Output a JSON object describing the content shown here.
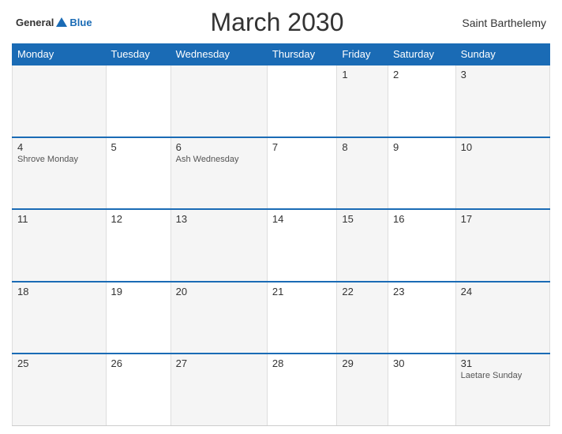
{
  "header": {
    "logo_general": "General",
    "logo_blue": "Blue",
    "title": "March 2030",
    "region": "Saint Barthelemy"
  },
  "days_of_week": [
    "Monday",
    "Tuesday",
    "Wednesday",
    "Thursday",
    "Friday",
    "Saturday",
    "Sunday"
  ],
  "weeks": [
    [
      {
        "day": "",
        "event": ""
      },
      {
        "day": "",
        "event": ""
      },
      {
        "day": "",
        "event": ""
      },
      {
        "day": "",
        "event": ""
      },
      {
        "day": "1",
        "event": ""
      },
      {
        "day": "2",
        "event": ""
      },
      {
        "day": "3",
        "event": ""
      }
    ],
    [
      {
        "day": "4",
        "event": "Shrove Monday"
      },
      {
        "day": "5",
        "event": ""
      },
      {
        "day": "6",
        "event": "Ash Wednesday"
      },
      {
        "day": "7",
        "event": ""
      },
      {
        "day": "8",
        "event": ""
      },
      {
        "day": "9",
        "event": ""
      },
      {
        "day": "10",
        "event": ""
      }
    ],
    [
      {
        "day": "11",
        "event": ""
      },
      {
        "day": "12",
        "event": ""
      },
      {
        "day": "13",
        "event": ""
      },
      {
        "day": "14",
        "event": ""
      },
      {
        "day": "15",
        "event": ""
      },
      {
        "day": "16",
        "event": ""
      },
      {
        "day": "17",
        "event": ""
      }
    ],
    [
      {
        "day": "18",
        "event": ""
      },
      {
        "day": "19",
        "event": ""
      },
      {
        "day": "20",
        "event": ""
      },
      {
        "day": "21",
        "event": ""
      },
      {
        "day": "22",
        "event": ""
      },
      {
        "day": "23",
        "event": ""
      },
      {
        "day": "24",
        "event": ""
      }
    ],
    [
      {
        "day": "25",
        "event": ""
      },
      {
        "day": "26",
        "event": ""
      },
      {
        "day": "27",
        "event": ""
      },
      {
        "day": "28",
        "event": ""
      },
      {
        "day": "29",
        "event": ""
      },
      {
        "day": "30",
        "event": ""
      },
      {
        "day": "31",
        "event": "Laetare Sunday"
      }
    ]
  ]
}
